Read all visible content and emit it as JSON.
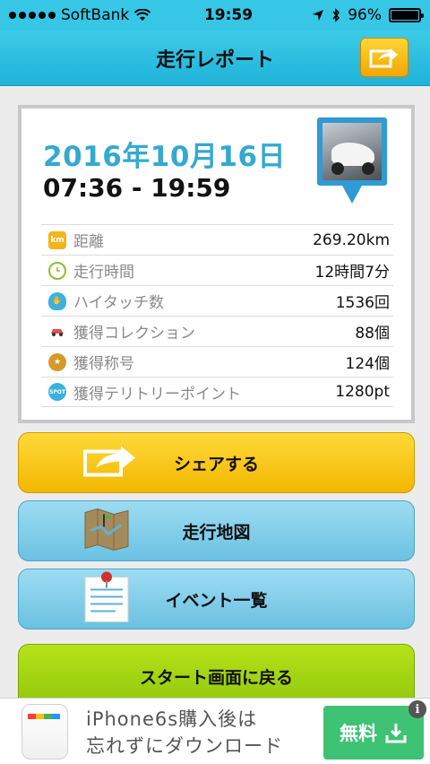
{
  "status_bar": {
    "carrier": "SoftBank",
    "time": "19:59",
    "battery": "96%"
  },
  "nav": {
    "title": "走行レポート",
    "share_icon": "share-arrow-icon"
  },
  "report": {
    "date": "2016年10月16日",
    "time_range": "07:36 - 19:59",
    "stats": [
      {
        "icon": "km-icon",
        "label": "距離",
        "value": "269.20km",
        "color": "#f2b51c"
      },
      {
        "icon": "clock-icon",
        "label": "走行時間",
        "value": "12時間7分",
        "color": "#8cbf2e"
      },
      {
        "icon": "hand-icon",
        "label": "ハイタッチ数",
        "value": "1536回",
        "color": "#3ab1e0"
      },
      {
        "icon": "car-icon",
        "label": "獲得コレクション",
        "value": "88個",
        "color": "#e05050"
      },
      {
        "icon": "medal-icon",
        "label": "獲得称号",
        "value": "124個",
        "color": "#d49a2a"
      },
      {
        "icon": "spot-icon",
        "label": "獲得テリトリーポイント",
        "value": "1280pt",
        "color": "#3ab1e0"
      }
    ]
  },
  "buttons": {
    "share": "シェアする",
    "map": "走行地図",
    "events": "イベント一覧",
    "start": "スタート画面に戻る"
  },
  "ad": {
    "line1": "iPhone6s購入後は",
    "line2": "忘れずにダウンロード",
    "cta": "無料",
    "info": "i"
  }
}
